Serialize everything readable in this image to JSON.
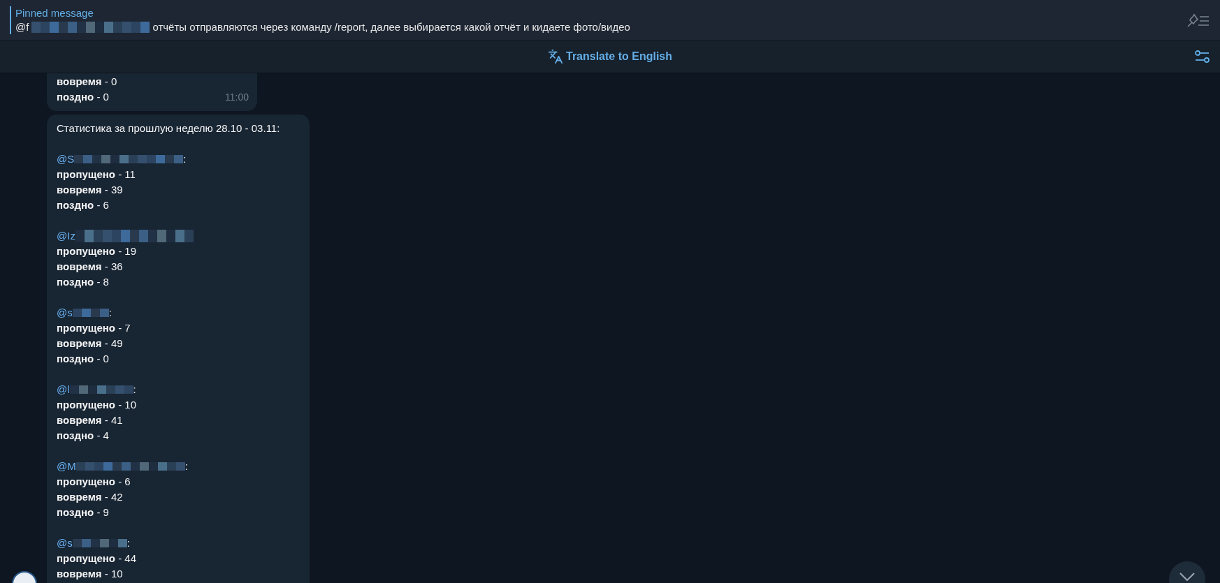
{
  "pinned": {
    "title": "Pinned message",
    "mention": "@f",
    "text": "отчёты отправляются через команду /report, далее выбирается какой отчёт и кидаете фото/видео"
  },
  "translate_bar": {
    "label": "Translate to English"
  },
  "messages": [
    {
      "lines": [
        "**вовремя** - 0",
        "**поздно** - 0"
      ],
      "time": "11:00"
    },
    {
      "heading": "Статистика за прошлую неделю 28.10 - 03.11:",
      "users": [
        {
          "mention": "@S",
          "suffix": ":",
          "lines": [
            "**пропущено** - 11",
            "**вовремя** - 39",
            "**поздно** - 6"
          ]
        },
        {
          "mention": "@Iz",
          "lines": [
            "**пропущено** - 19",
            "**вовремя** - 36",
            "**поздно** - 8"
          ]
        },
        {
          "mention": "@s",
          "suffix": ":",
          "lines": [
            "**пропущено** - 7",
            "**вовремя** - 49",
            "**поздно** - 0"
          ]
        },
        {
          "mention": "@l",
          "suffix": ":",
          "lines": [
            "**пропущено** - 10",
            "**вовремя** - 41",
            "**поздно** - 4"
          ]
        },
        {
          "mention": "@M",
          "suffix": ":",
          "lines": [
            "**пропущено** - 6",
            "**вовремя** - 42",
            "**поздно** - 9"
          ]
        },
        {
          "mention": "@s",
          "suffix": ":",
          "lines": [
            "**пропущено** - 44",
            "**вовремя** - 10"
          ]
        }
      ]
    }
  ]
}
